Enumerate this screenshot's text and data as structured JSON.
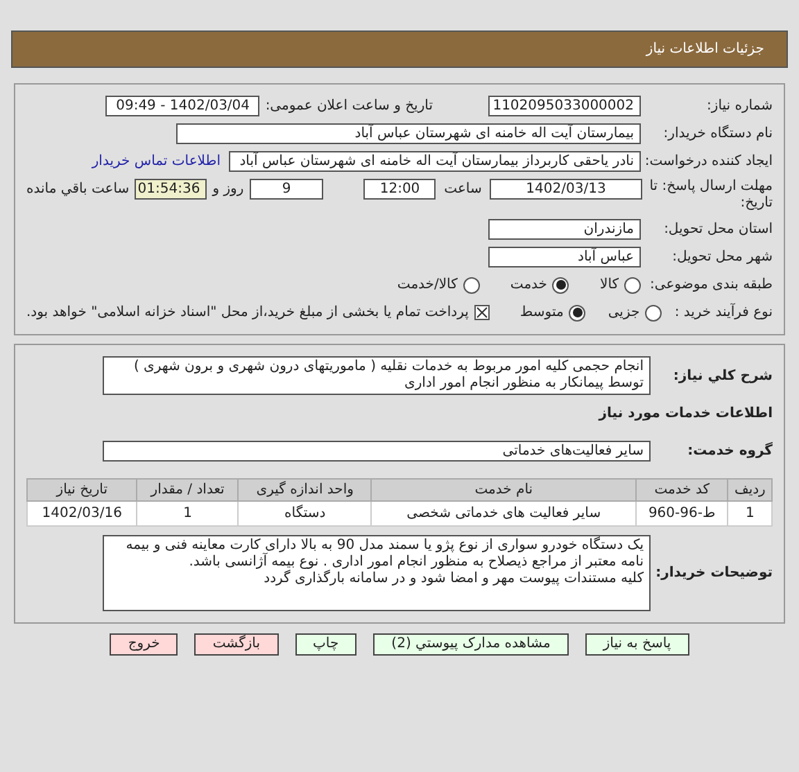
{
  "header": {
    "title": "جزئیات اطلاعات نیاز"
  },
  "details": {
    "need_number": {
      "label": "شماره نیاز:",
      "value": "1102095033000002"
    },
    "announce": {
      "label": "تاریخ و ساعت اعلان عمومی:",
      "value": "1402/03/04 - 09:49"
    },
    "buyer": {
      "label": "نام دستگاه خریدار:",
      "value": "بیمارستان آیت اله خامنه ای شهرستان عباس آباد"
    },
    "creator": {
      "label": "ایجاد کننده درخواست:",
      "value": "نادر یاحقی کاربرداز بیمارستان آیت اله خامنه ای شهرستان عباس آباد",
      "link": "اطلاعات تماس خریدار"
    },
    "deadline": {
      "label": "مهلت ارسال پاسخ: تا تاریخ:",
      "date": "1402/03/13",
      "time_label": "ساعت",
      "time": "12:00",
      "days": "9",
      "days_label": "روز و",
      "remaining": "01:54:36",
      "remaining_label": "ساعت باقي مانده"
    },
    "province": {
      "label": "استان محل تحویل:",
      "value": "مازندران"
    },
    "city": {
      "label": "شهر محل تحویل:",
      "value": "عباس آباد"
    },
    "category": {
      "label": "طبقه بندی موضوعی:",
      "options": [
        {
          "label": "کالا",
          "selected": false
        },
        {
          "label": "خدمت",
          "selected": true
        },
        {
          "label": "کالا/خدمت",
          "selected": false
        }
      ]
    },
    "process": {
      "label": "نوع فرآیند خرید :",
      "options": [
        {
          "label": "جزیی",
          "selected": false
        },
        {
          "label": "متوسط",
          "selected": true
        }
      ],
      "treasury": {
        "checked": true,
        "text": "پرداخت تمام یا بخشی از مبلغ خرید،از محل \"اسناد خزانه اسلامی\" خواهد بود."
      }
    }
  },
  "summary": {
    "label": "شرح کلي نياز:",
    "text": "انجام حجمی کلیه امور مربوط به خدمات نقلیه ( ماموریتهای درون شهری و برون شهری ) توسط پیمانکار به منظور انجام امور اداری"
  },
  "services": {
    "heading": "اطلاعات خدمات مورد نياز",
    "group_label": "گروه خدمت:",
    "group": "سایر فعالیت‌های خدماتی",
    "table": {
      "columns": [
        "ردیف",
        "کد خدمت",
        "نام خدمت",
        "واحد اندازه گیری",
        "تعداد / مقدار",
        "تاریخ نیاز"
      ],
      "rows": [
        [
          "1",
          "ط-96-960",
          "سایر فعالیت های خدماتی شخصی",
          "دستگاه",
          "1",
          "1402/03/16"
        ]
      ]
    }
  },
  "notes": {
    "label": "توضیحات خریدار:",
    "lines": [
      "یک دستگاه خودرو سواری از نوع پژو یا سمند مدل 90 به بالا دارای کارت معاینه فنی و بیمه نامه معتبر از مراجع ذیصلاح به منظور انجام امور اداری . نوع بیمه آژانسی باشد.",
      "کلیه مستندات پیوست مهر و امضا شود و در سامانه بارگذاری گردد"
    ]
  },
  "buttons": [
    {
      "label": "پاسخ به نیاز",
      "kind": "primary"
    },
    {
      "label": "مشاهده مدارک پیوستي (2)",
      "kind": "primary"
    },
    {
      "label": "چاپ",
      "kind": "primary"
    },
    {
      "label": "بازگشت",
      "kind": "danger"
    },
    {
      "label": "خروج",
      "kind": "danger"
    }
  ]
}
